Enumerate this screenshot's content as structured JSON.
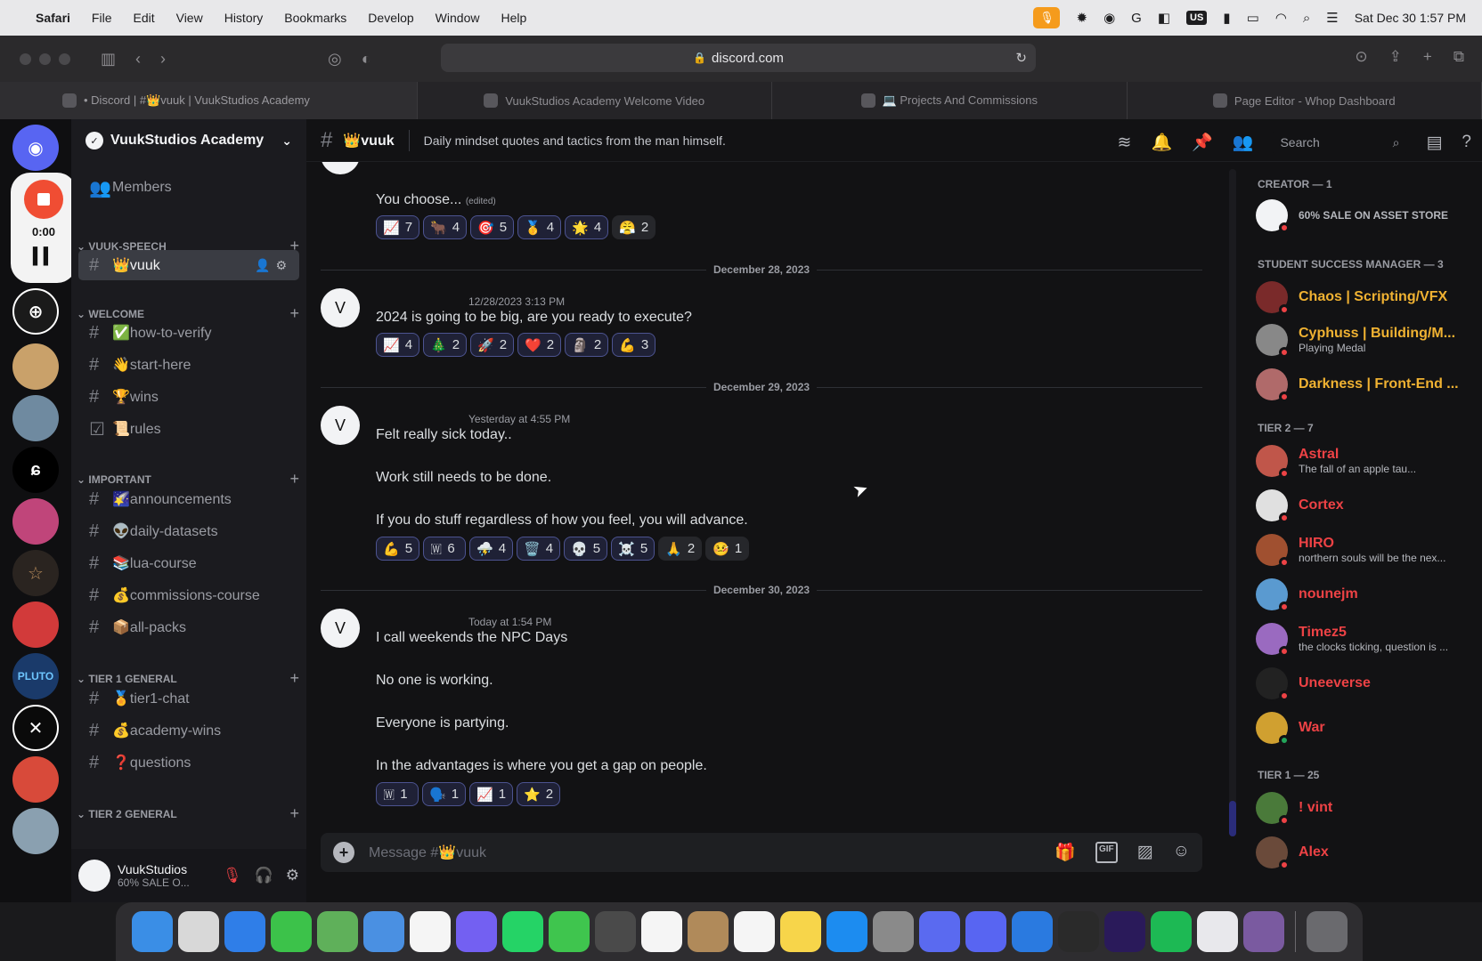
{
  "menubar": {
    "apple": "",
    "app": "Safari",
    "items": [
      "File",
      "Edit",
      "View",
      "History",
      "Bookmarks",
      "Develop",
      "Window",
      "Help"
    ],
    "us_label": "US",
    "datetime": "Sat Dec 30  1:57 PM"
  },
  "browser": {
    "url": "discord.com",
    "tabs": [
      "• Discord | #👑vuuk | VuukStudios Academy",
      "VuukStudios Academy Welcome Video",
      "💻 Projects And Commissions",
      "Page Editor - Whop Dashboard"
    ]
  },
  "recorder": {
    "time": "0:00"
  },
  "server": {
    "name": "VuukStudios Academy",
    "members_label": "Members",
    "categories": {
      "speech": "VUUK-SPEECH",
      "welcome": "WELCOME",
      "important": "IMPORTANT",
      "tier1": "TIER 1 GENERAL",
      "tier2": "TIER 2 GENERAL"
    },
    "channels": {
      "vuuk": "👑vuuk",
      "verify": "✅how-to-verify",
      "start": "👋start-here",
      "wins": "🏆wins",
      "rules": "📜rules",
      "announcements": "🌠announcements",
      "datasets": "👽daily-datasets",
      "lua": "📚lua-course",
      "commissions": "💰commissions-course",
      "packs": "📦all-packs",
      "tier1chat": "🏅tier1-chat",
      "academywins": "💰academy-wins",
      "questions": "❓questions"
    }
  },
  "user": {
    "name": "VuukStudios",
    "status": "60% SALE O..."
  },
  "channel": {
    "name": "👑vuuk",
    "topic": "Daily mindset quotes and tactics from the man himself.",
    "search_placeholder": "Search"
  },
  "messages": {
    "first": {
      "text": "You choose...",
      "edited": "(edited)",
      "reactions": [
        {
          "emoji": "📈",
          "count": "7"
        },
        {
          "emoji": "🐂",
          "count": "4"
        },
        {
          "emoji": "🎯",
          "count": "5"
        },
        {
          "emoji": "🥇",
          "count": "4"
        },
        {
          "emoji": "🌟",
          "count": "4"
        },
        {
          "emoji": "😤",
          "count": "2"
        }
      ]
    },
    "d1": "December 28, 2023",
    "second": {
      "timestamp": "12/28/2023 3:13 PM",
      "text": "2024 is going to be big, are you ready to execute?",
      "reactions": [
        {
          "emoji": "📈",
          "count": "4"
        },
        {
          "emoji": "🎄",
          "count": "2"
        },
        {
          "emoji": "🚀",
          "count": "2"
        },
        {
          "emoji": "❤️",
          "count": "2"
        },
        {
          "emoji": "🗿",
          "count": "2"
        },
        {
          "emoji": "💪",
          "count": "3"
        }
      ]
    },
    "d2": "December 29, 2023",
    "third": {
      "timestamp": "Yesterday at 4:55 PM",
      "l1": "Felt really sick today..",
      "l2": "Work still needs to be done.",
      "l3": "If you do stuff regardless of how you feel, you will advance.",
      "reactions": [
        {
          "emoji": "💪",
          "count": "5"
        },
        {
          "emoji": "🇼",
          "count": "6"
        },
        {
          "emoji": "⛈️",
          "count": "4"
        },
        {
          "emoji": "🗑️",
          "count": "4"
        },
        {
          "emoji": "💀",
          "count": "5"
        },
        {
          "emoji": "☠️",
          "count": "5"
        },
        {
          "emoji": "🙏",
          "count": "2"
        },
        {
          "emoji": "🤒",
          "count": "1"
        }
      ]
    },
    "d3": "December 30, 2023",
    "fourth": {
      "timestamp": "Today at 1:54 PM",
      "l1": "I call weekends the NPC Days",
      "l2": "No one is working.",
      "l3": "Everyone is partying.",
      "l4": "In the advantages is where you get a gap on people.",
      "reactions": [
        {
          "emoji": "🇼",
          "count": "1"
        },
        {
          "emoji": "🗣️",
          "count": "1"
        },
        {
          "emoji": "📈",
          "count": "1"
        },
        {
          "emoji": "⭐",
          "count": "2"
        }
      ]
    }
  },
  "composer": {
    "placeholder": "Message #👑vuuk",
    "gif": "GIF"
  },
  "members": {
    "creator": "CREATOR — 1",
    "creator_status": "60% SALE ON ASSET STORE",
    "ssm": "STUDENT SUCCESS MANAGER — 3",
    "chaos": "Chaos | Scripting/VFX",
    "cyphuss": "Cyphuss | Building/M...",
    "cyphuss_status": "Playing Medal",
    "darkness": "Darkness | Front-End ...",
    "tier2": "TIER 2 — 7",
    "astral": "Astral",
    "astral_status": "The fall of an apple tau...",
    "cortex": "Cortex",
    "hiro": "HIRO",
    "hiro_status": "northern souls will be the nex...",
    "nounejm": "nounejm",
    "timez5": "Timez5",
    "timez5_status": "the clocks ticking, question is ...",
    "uneeverse": "Uneeverse",
    "war": "War",
    "tier1": "TIER 1 — 25",
    "vint": "! vint",
    "alex": "Alex"
  },
  "colors": {
    "gold": "#f0b232",
    "red": "#ed4245",
    "accent": "#5865f2"
  }
}
